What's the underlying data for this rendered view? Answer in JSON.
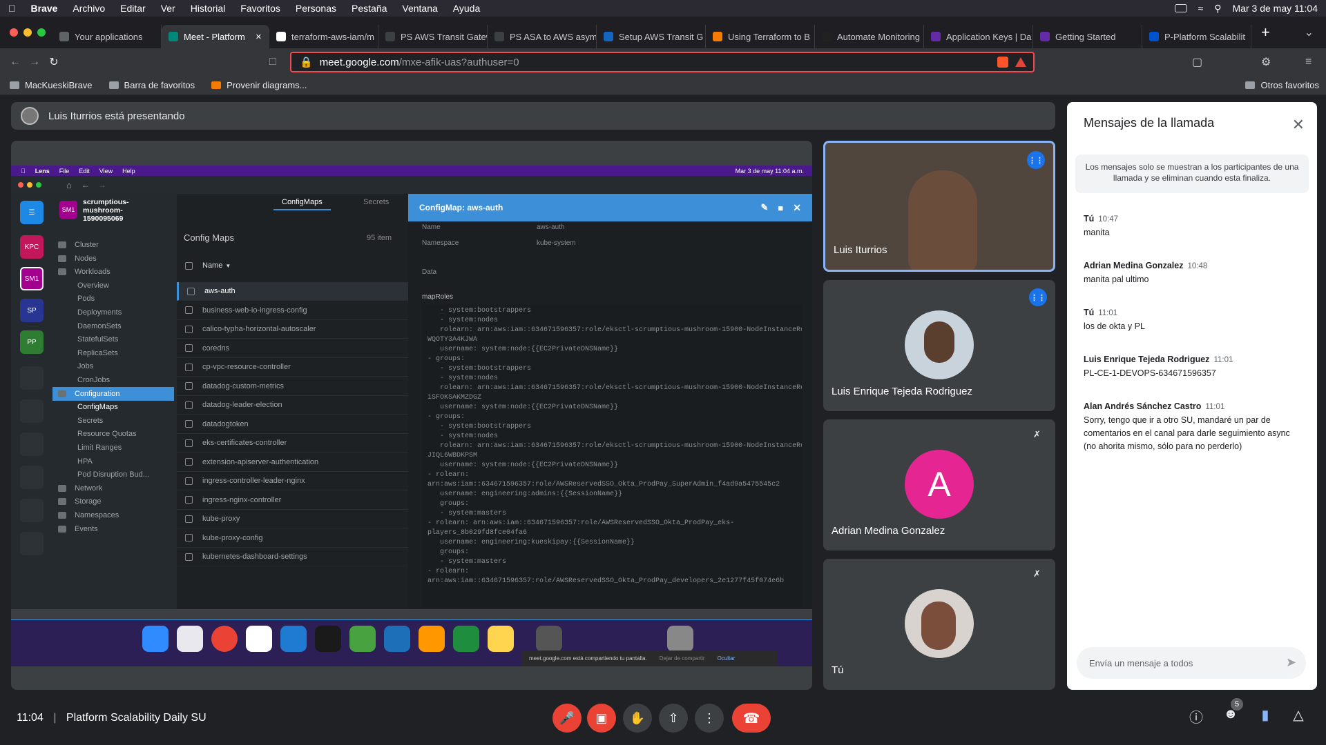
{
  "menubar": {
    "app": "Brave",
    "items": [
      "Archivo",
      "Editar",
      "Ver",
      "Historial",
      "Favoritos",
      "Personas",
      "Pestaña",
      "Ventana",
      "Ayuda"
    ],
    "datetime": "Mar 3 de may  11:04"
  },
  "tabs": [
    {
      "title": "Your applications",
      "color": "#5f6368"
    },
    {
      "title": "Meet - Platform",
      "color": "#00897b",
      "active": true
    },
    {
      "title": "terraform-aws-iam/m",
      "color": "#ffffff"
    },
    {
      "title": "PS  AWS Transit Gateway",
      "color": "#3c4043"
    },
    {
      "title": "PS  ASA to AWS asymme",
      "color": "#3c4043"
    },
    {
      "title": "Setup AWS Transit G",
      "color": "#1565c0"
    },
    {
      "title": "Using Terraform to B",
      "color": "#f57c00"
    },
    {
      "title": "Automate Monitoring",
      "color": "#212121"
    },
    {
      "title": "Application Keys | Da",
      "color": "#632ca6"
    },
    {
      "title": "Getting Started",
      "color": "#632ca6"
    },
    {
      "title": "P-Platform Scalabilit",
      "color": "#0052cc"
    }
  ],
  "address": {
    "host": "meet.google.com",
    "path": "/mxe-afik-uas?authuser=0"
  },
  "bookmarks": [
    "MacKueskiBrave",
    "Barra de favoritos",
    "Provenir diagrams...",
    "Otros favoritos"
  ],
  "presenter": "Luis Iturrios está presentando",
  "lens": {
    "menubar": [
      "Lens",
      "File",
      "Edit",
      "View",
      "Help"
    ],
    "status_datetime": "Mar 3 de may  11:04 a.m.",
    "cluster_name": "scrumptious-mushroom-1590095069",
    "cluster_badge": "SM1",
    "hotbar": [
      {
        "label": "KPC",
        "color": "#c2185b"
      },
      {
        "label": "SM1",
        "color": "#a4008f"
      },
      {
        "label": "SP",
        "color": "#283593"
      },
      {
        "label": "PP",
        "color": "#2e7d32"
      }
    ],
    "sidebar": [
      {
        "label": "Cluster",
        "sub": false
      },
      {
        "label": "Nodes",
        "sub": false
      },
      {
        "label": "Workloads",
        "sub": false
      },
      {
        "label": "Overview",
        "sub": true
      },
      {
        "label": "Pods",
        "sub": true
      },
      {
        "label": "Deployments",
        "sub": true
      },
      {
        "label": "DaemonSets",
        "sub": true
      },
      {
        "label": "StatefulSets",
        "sub": true
      },
      {
        "label": "ReplicaSets",
        "sub": true
      },
      {
        "label": "Jobs",
        "sub": true
      },
      {
        "label": "CronJobs",
        "sub": true
      },
      {
        "label": "Configuration",
        "sub": false,
        "active": true
      },
      {
        "label": "ConfigMaps",
        "sub": true,
        "selected": true
      },
      {
        "label": "Secrets",
        "sub": true
      },
      {
        "label": "Resource Quotas",
        "sub": true
      },
      {
        "label": "Limit Ranges",
        "sub": true
      },
      {
        "label": "HPA",
        "sub": true
      },
      {
        "label": "Pod Disruption Bud...",
        "sub": true
      },
      {
        "label": "Network",
        "sub": false
      },
      {
        "label": "Storage",
        "sub": false
      },
      {
        "label": "Namespaces",
        "sub": false
      },
      {
        "label": "Events",
        "sub": false
      }
    ],
    "tabs": [
      "ConfigMaps",
      "Secrets"
    ],
    "list_title": "Config Maps",
    "item_count": "95 item",
    "col_name": "Name",
    "configmaps": [
      "aws-auth",
      "business-web-io-ingress-config",
      "calico-typha-horizontal-autoscaler",
      "coredns",
      "cp-vpc-resource-controller",
      "datadog-custom-metrics",
      "datadog-leader-election",
      "datadogtoken",
      "eks-certificates-controller",
      "extension-apiserver-authentication",
      "ingress-controller-leader-nginx",
      "ingress-nginx-controller",
      "kube-proxy",
      "kube-proxy-config",
      "kubernetes-dashboard-settings"
    ],
    "detail_title": "ConfigMap: aws-auth",
    "detail_name_label": "Name",
    "detail_name": "aws-auth",
    "detail_ns_label": "Namespace",
    "detail_ns": "kube-system",
    "data_label": "Data",
    "maproles_label": "mapRoles",
    "maproles_lines": [
      "   - system:bootstrappers",
      "   - system:nodes",
      "   rolearn: arn:aws:iam::634671596357:role/eksctl-scrumptious-mushroom-15900-NodeInstanceRole-",
      "WQOTY3A4KJWA",
      "   username: system:node:{{EC2PrivateDNSName}}",
      "- groups:",
      "   - system:bootstrappers",
      "   - system:nodes",
      "   rolearn: arn:aws:iam::634671596357:role/eksctl-scrumptious-mushroom-15900-NodeInstanceRole-",
      "1SFOKSAKMZDGZ",
      "   username: system:node:{{EC2PrivateDNSName}}",
      "- groups:",
      "   - system:bootstrappers",
      "   - system:nodes",
      "   rolearn: arn:aws:iam::634671596357:role/eksctl-scrumptious-mushroom-15900-NodeInstanceRole-",
      "JIQL6WBDKPSM",
      "   username: system:node:{{EC2PrivateDNSName}}",
      "- rolearn:",
      "arn:aws:iam::634671596357:role/AWSReservedSSO_Okta_ProdPay_SuperAdmin_f4ad9a5475545c2",
      "   username: engineering:admins:{{SessionName}}",
      "   groups:",
      "   - system:masters",
      "- rolearn: arn:aws:iam::634671596357:role/AWSReservedSSO_Okta_ProdPay_eks-",
      "players_8b029fd8fce04fa6",
      "   username: engineering:kueskipay:{{SessionName}}",
      "   groups:",
      "   - system:masters",
      "- rolearn:",
      "arn:aws:iam::634671596357:role/AWSReservedSSO_Okta_ProdPay_developers_2e1277f45f074e6b"
    ],
    "share_notice": "meet.google.com está compartiendo tu pantalla.",
    "stop_share": "Dejar de compartir",
    "hide": "Ocultar"
  },
  "participants": [
    {
      "name": "Luis Iturrios",
      "speaking": true,
      "type": "video"
    },
    {
      "name": "Luis Enrique Tejeda Rodriguez",
      "speaking": true,
      "type": "photo"
    },
    {
      "name": "Adrian Medina Gonzalez",
      "muted": true,
      "type": "letter",
      "letter": "A",
      "color": "#e52592"
    },
    {
      "name": "Tú",
      "muted": true,
      "type": "photo"
    }
  ],
  "chat": {
    "title": "Mensajes de la llamada",
    "note": "Los mensajes solo se muestran a los participantes de una llamada y se eliminan cuando esta finaliza.",
    "messages": [
      {
        "author": "Tú",
        "time": "10:47",
        "text": "manita"
      },
      {
        "author": "Adrian Medina Gonzalez",
        "time": "10:48",
        "text": "manita pal ultimo"
      },
      {
        "author": "Tú",
        "time": "11:01",
        "text": "los de okta y PL"
      },
      {
        "author": "Luis Enrique Tejeda Rodriguez",
        "time": "11:01",
        "text": "PL-CE-1-DEVOPS-634671596357"
      },
      {
        "author": "Alan Andrés Sánchez Castro",
        "time": "11:01",
        "text": "Sorry, tengo que ir a otro SU, mandaré un par de comentarios en el canal para darle seguimiento async (no ahorita mismo, sólo para no perderlo)"
      }
    ],
    "placeholder": "Envía un mensaje a todos"
  },
  "bottom": {
    "time": "11:04",
    "meeting": "Platform Scalability Daily SU",
    "people_count": "5"
  }
}
